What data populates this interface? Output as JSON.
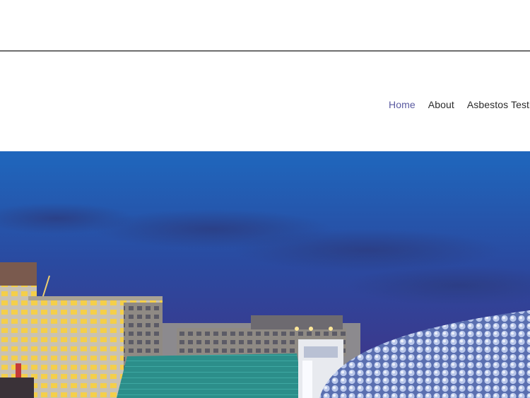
{
  "nav": {
    "items": [
      {
        "label": "Home",
        "active": true
      },
      {
        "label": "About",
        "active": false
      },
      {
        "label": "Asbestos Testin",
        "active": false
      }
    ],
    "active_color": "#5a5aa0",
    "text_color": "#2b2b2b"
  },
  "hero": {
    "image": "city-skyline-dusk"
  }
}
